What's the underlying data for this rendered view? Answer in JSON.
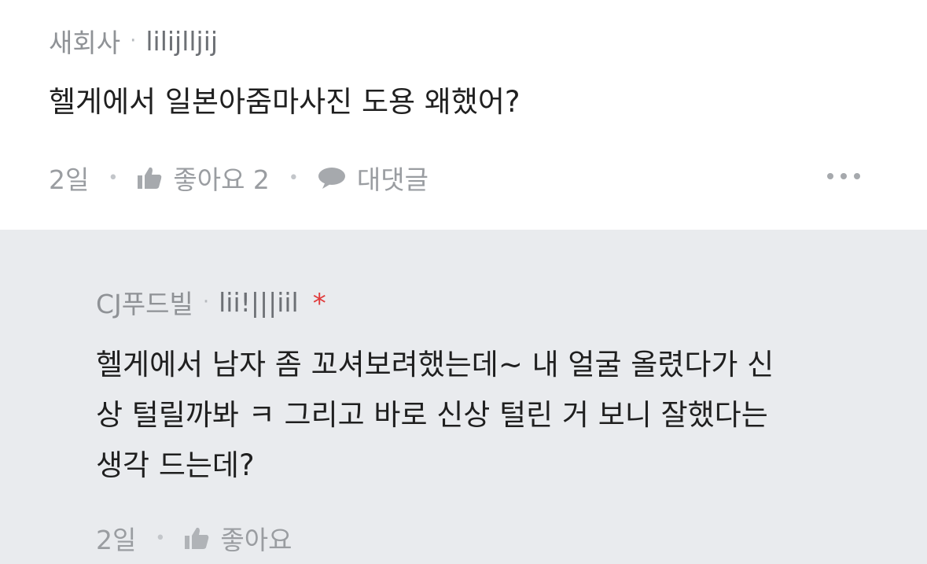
{
  "comment": {
    "company": "새회사",
    "separator": "·",
    "handle": "lilijlljij",
    "text": "헬게에서 일본아줌마사진 도용 왜했어?",
    "time": "2일",
    "like_label": "좋아요 2",
    "reply_label": "대댓글",
    "icons": [
      "thumbs-up-icon",
      "speech-bubble-icon",
      "more-dots-icon"
    ]
  },
  "reply": {
    "company": "CJ푸드빌",
    "separator": "·",
    "handle": "lii!|||iil",
    "badge": "*",
    "text_lines": [
      "헬게에서 남자 좀 꼬셔보려했는데~ 내 얼굴 올렸다가 신",
      "상 털릴까봐 ㅋ 그리고 바로 신상 털린 거 보니 잘했다는",
      "생각 드는데?"
    ],
    "time": "2일",
    "like_label": "좋아요",
    "icons": [
      "thumbs-up-icon"
    ]
  },
  "colors": {
    "reply_background": "#e9ebee",
    "meta_text": "#8f9296",
    "badge": "#e03a3a"
  }
}
